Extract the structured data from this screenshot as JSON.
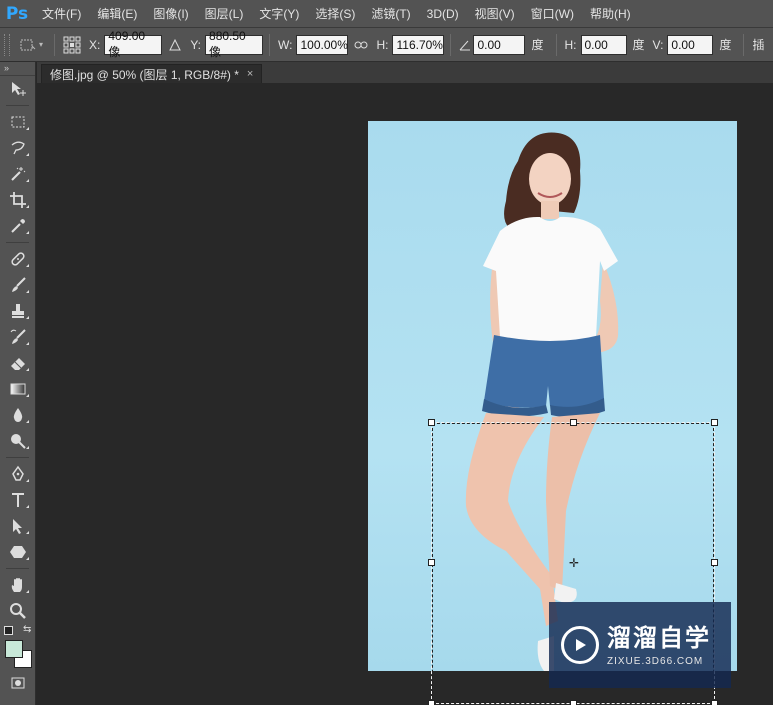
{
  "app": {
    "logo": "Ps"
  },
  "menu": [
    "文件(F)",
    "编辑(E)",
    "图像(I)",
    "图层(L)",
    "文字(Y)",
    "选择(S)",
    "滤镜(T)",
    "3D(D)",
    "视图(V)",
    "窗口(W)",
    "帮助(H)"
  ],
  "options": {
    "x_label": "X:",
    "x_value": "409.00 像",
    "y_label": "Y:",
    "y_value": "880.50 像",
    "w_label": "W:",
    "w_value": "100.00%",
    "h_label": "H:",
    "h_value": "116.70%",
    "angle_value": "0.00",
    "angle_unit": "度",
    "skew_h_label": "H:",
    "skew_h_value": "0.00",
    "skew_h_unit": "度",
    "skew_v_label": "V:",
    "skew_v_value": "0.00",
    "skew_v_unit": "度",
    "interp_label": "插"
  },
  "document": {
    "tab_title": "修图.jpg @ 50% (图层 1, RGB/8#) *",
    "close": "×"
  },
  "tools": [
    "move-tool",
    "marquee-tool",
    "lasso-tool",
    "magic-wand-tool",
    "crop-tool",
    "eyedropper-tool",
    "healing-brush-tool",
    "brush-tool",
    "clone-stamp-tool",
    "history-brush-tool",
    "eraser-tool",
    "gradient-tool",
    "blur-tool",
    "dodge-tool",
    "pen-tool",
    "type-tool",
    "path-selection-tool",
    "shape-tool",
    "hand-tool",
    "zoom-tool"
  ],
  "colors": {
    "foreground": "#c8e8d8",
    "background": "#ffffff",
    "photo_bg": "#acdcee",
    "accent": "#31a8ff"
  },
  "watermark": {
    "title": "溜溜自学",
    "url": "ZIXUE.3D66.COM"
  }
}
